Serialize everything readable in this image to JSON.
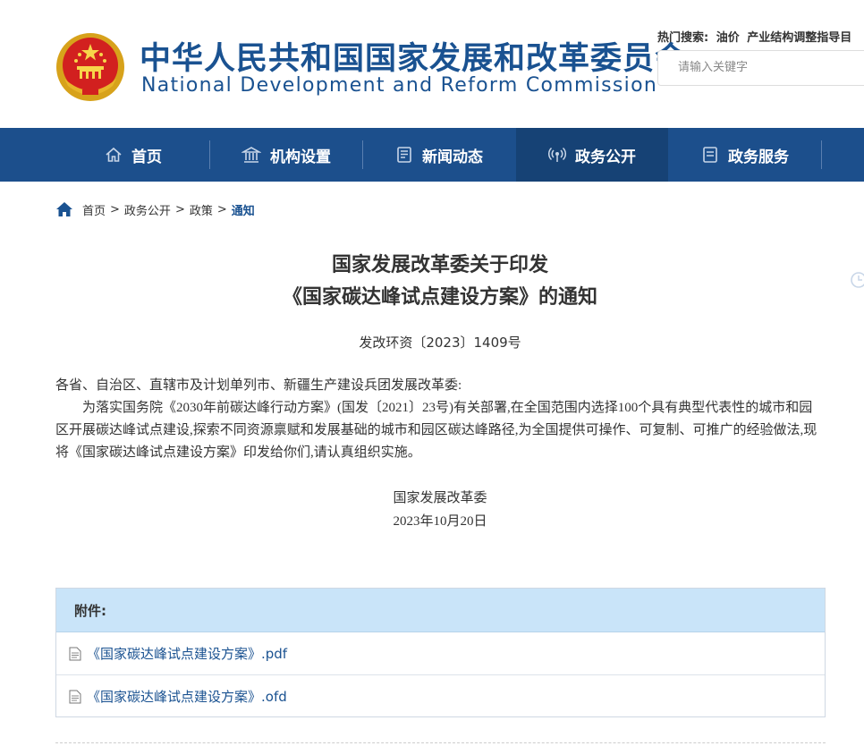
{
  "header": {
    "title_zh": "中华人民共和国国家发展和改革委员会",
    "title_en": "National Development and Reform Commission",
    "hot_label": "热门搜索:",
    "hot_keywords": [
      "油价",
      "产业结构调整指导目"
    ],
    "search_placeholder": "请输入关键字"
  },
  "nav": {
    "items": [
      {
        "label": "首页",
        "icon": "home-icon"
      },
      {
        "label": "机构设置",
        "icon": "building-icon"
      },
      {
        "label": "新闻动态",
        "icon": "news-icon"
      },
      {
        "label": "政务公开",
        "icon": "broadcast-icon",
        "active": true
      },
      {
        "label": "政务服务",
        "icon": "document-icon"
      }
    ]
  },
  "breadcrumb": [
    "首页",
    "政务公开",
    "政策",
    "通知"
  ],
  "article": {
    "title_line1": "国家发展改革委关于印发",
    "title_line2": "《国家碳达峰试点建设方案》的通知",
    "doc_number": "发改环资〔2023〕1409号",
    "salutation": "各省、自治区、直辖市及计划单列市、新疆生产建设兵团发展改革委:",
    "paragraph": "为落实国务院《2030年前碳达峰行动方案》(国发〔2021〕23号)有关部署,在全国范围内选择100个具有典型代表性的城市和园区开展碳达峰试点建设,探索不同资源禀赋和发展基础的城市和园区碳达峰路径,为全国提供可操作、可复制、可推广的经验做法,现将《国家碳达峰试点建设方案》印发给你们,请认真组织实施。",
    "signer": "国家发展改革委",
    "date": "2023年10月20日"
  },
  "attachments": {
    "heading": "附件:",
    "files": [
      "《国家碳达峰试点建设方案》.pdf",
      "《国家碳达峰试点建设方案》.ofd"
    ]
  },
  "colors": {
    "brand_blue": "#1a5291",
    "nav_bg": "#1c4f8c",
    "nav_active": "#164275",
    "attach_head": "#c9e4f9"
  }
}
